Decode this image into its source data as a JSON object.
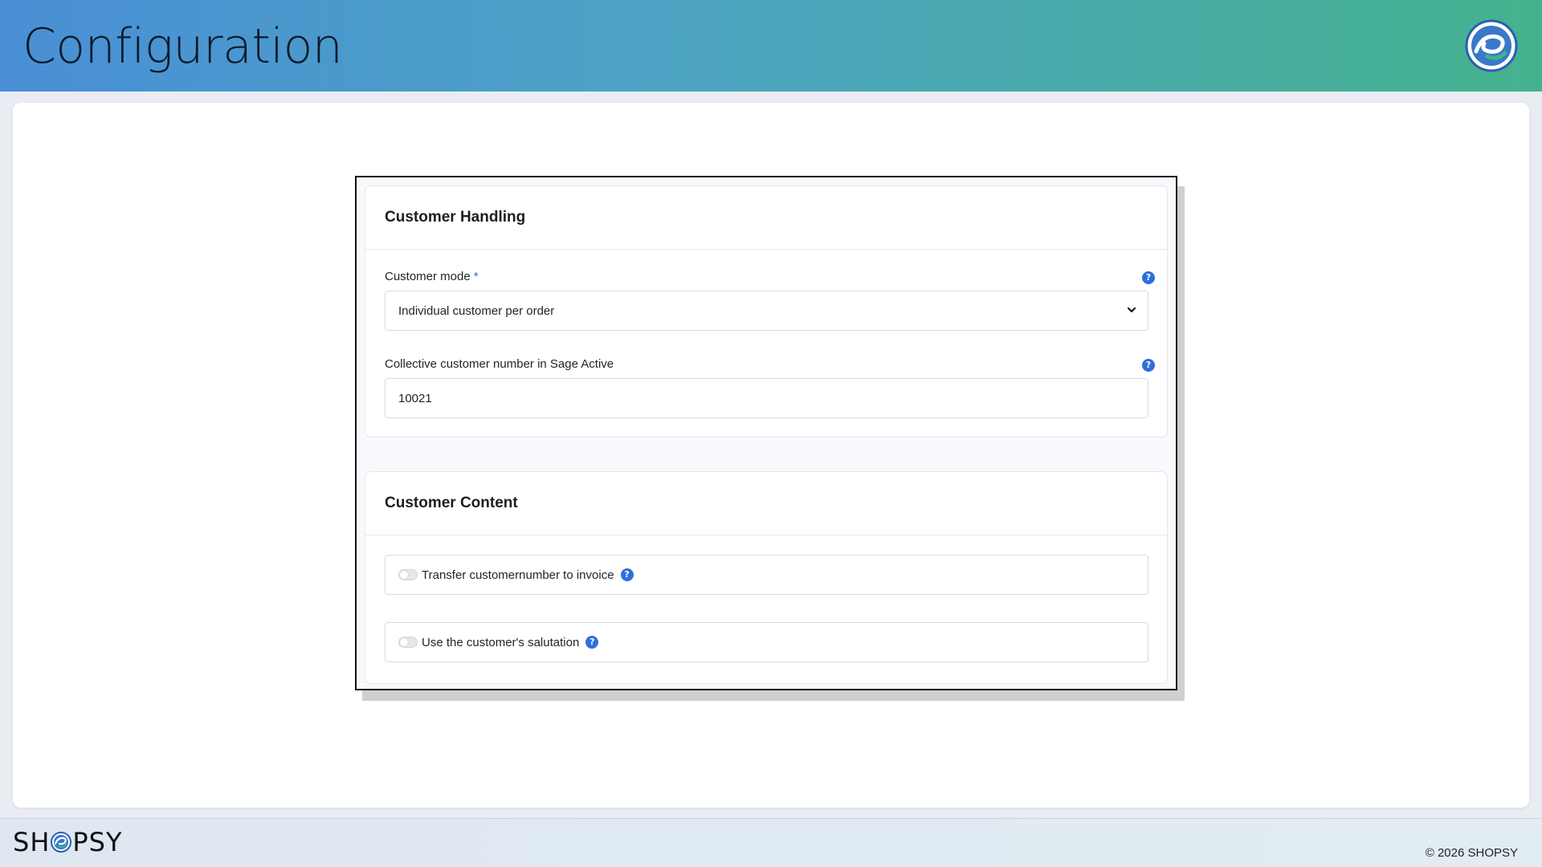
{
  "header": {
    "title": "Configuration",
    "logo_icon": "shopsy-logo-icon"
  },
  "customer_handling": {
    "title": "Customer Handling",
    "customer_mode": {
      "label": "Customer mode",
      "required_mark": "*",
      "value": "Individual customer per order"
    },
    "collective_number": {
      "label": "Collective customer number in Sage Active",
      "value": "10021"
    }
  },
  "customer_content": {
    "title": "Customer Content",
    "toggles": [
      {
        "label": "Transfer customernumber to invoice",
        "enabled": false
      },
      {
        "label": "Use the customer's salutation",
        "enabled": false
      }
    ]
  },
  "help_glyph": "?",
  "footer": {
    "brand_left": "SH",
    "brand_right": "PSY",
    "copyright": "© 2026 SHOPSY"
  },
  "colors": {
    "accent": "#2d6ee0",
    "header_start": "#4a8fd6",
    "header_end": "#45b28e"
  }
}
